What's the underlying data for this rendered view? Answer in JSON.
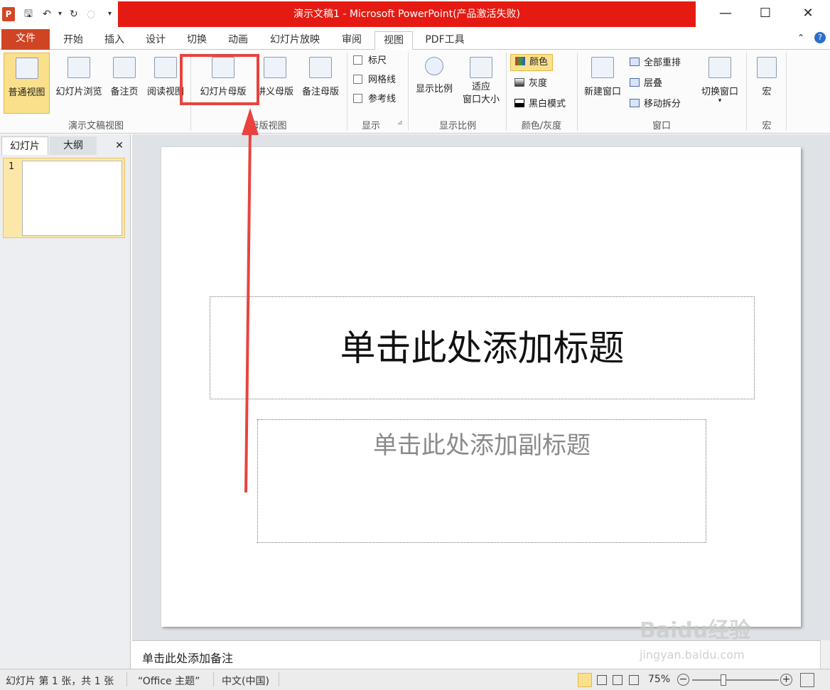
{
  "window": {
    "title": "演示文稿1 - Microsoft PowerPoint(产品激活失败)",
    "logo_letter": "P",
    "minimize": "—",
    "maximize": "☐",
    "close": "✕"
  },
  "tabs": [
    "文件",
    "开始",
    "插入",
    "设计",
    "切换",
    "动画",
    "幻灯片放映",
    "审阅",
    "视图",
    "PDF工具"
  ],
  "active_tab": "视图",
  "ribbon": {
    "presentation_views": {
      "label": "演示文稿视图",
      "buttons": [
        "普通视图",
        "幻灯片浏览",
        "备注页",
        "阅读视图"
      ]
    },
    "master_views": {
      "label": "母版视图",
      "buttons": [
        "幻灯片母版",
        "讲义母版",
        "备注母版"
      ]
    },
    "show": {
      "label": "显示",
      "checkboxes": [
        "标尺",
        "网格线",
        "参考线"
      ]
    },
    "zoom": {
      "label": "显示比例",
      "zoom_btn": "显示比例",
      "fit_btn_line1": "适应",
      "fit_btn_line2": "窗口大小"
    },
    "color": {
      "label": "颜色/灰度",
      "items": [
        "颜色",
        "灰度",
        "黑白模式"
      ]
    },
    "window": {
      "label": "窗口",
      "new_window": "新建窗口",
      "items": [
        "全部重排",
        "层叠",
        "移动拆分"
      ],
      "switch_window": "切换窗口"
    },
    "macros": {
      "label": "宏",
      "button": "宏"
    }
  },
  "left_pane": {
    "tab_slides": "幻灯片",
    "tab_outline": "大纲",
    "close": "✕",
    "slide_number": "1"
  },
  "slide": {
    "title_placeholder": "单击此处添加标题",
    "subtitle_placeholder": "单击此处添加副标题"
  },
  "notes_placeholder": "单击此处添加备注",
  "status": {
    "slide_info": "幻灯片 第 1 张，共 1 张",
    "theme": "“Office 主题”",
    "language": "中文(中国)",
    "zoom": "75%"
  },
  "watermark": {
    "main": "Baidu经验",
    "sub": "jingyan.baidu.com"
  },
  "colors": {
    "title_bar": "#e51b13",
    "file_tab": "#d04423",
    "annotation": "#e8433e",
    "selected_button": "#fbe08b"
  }
}
